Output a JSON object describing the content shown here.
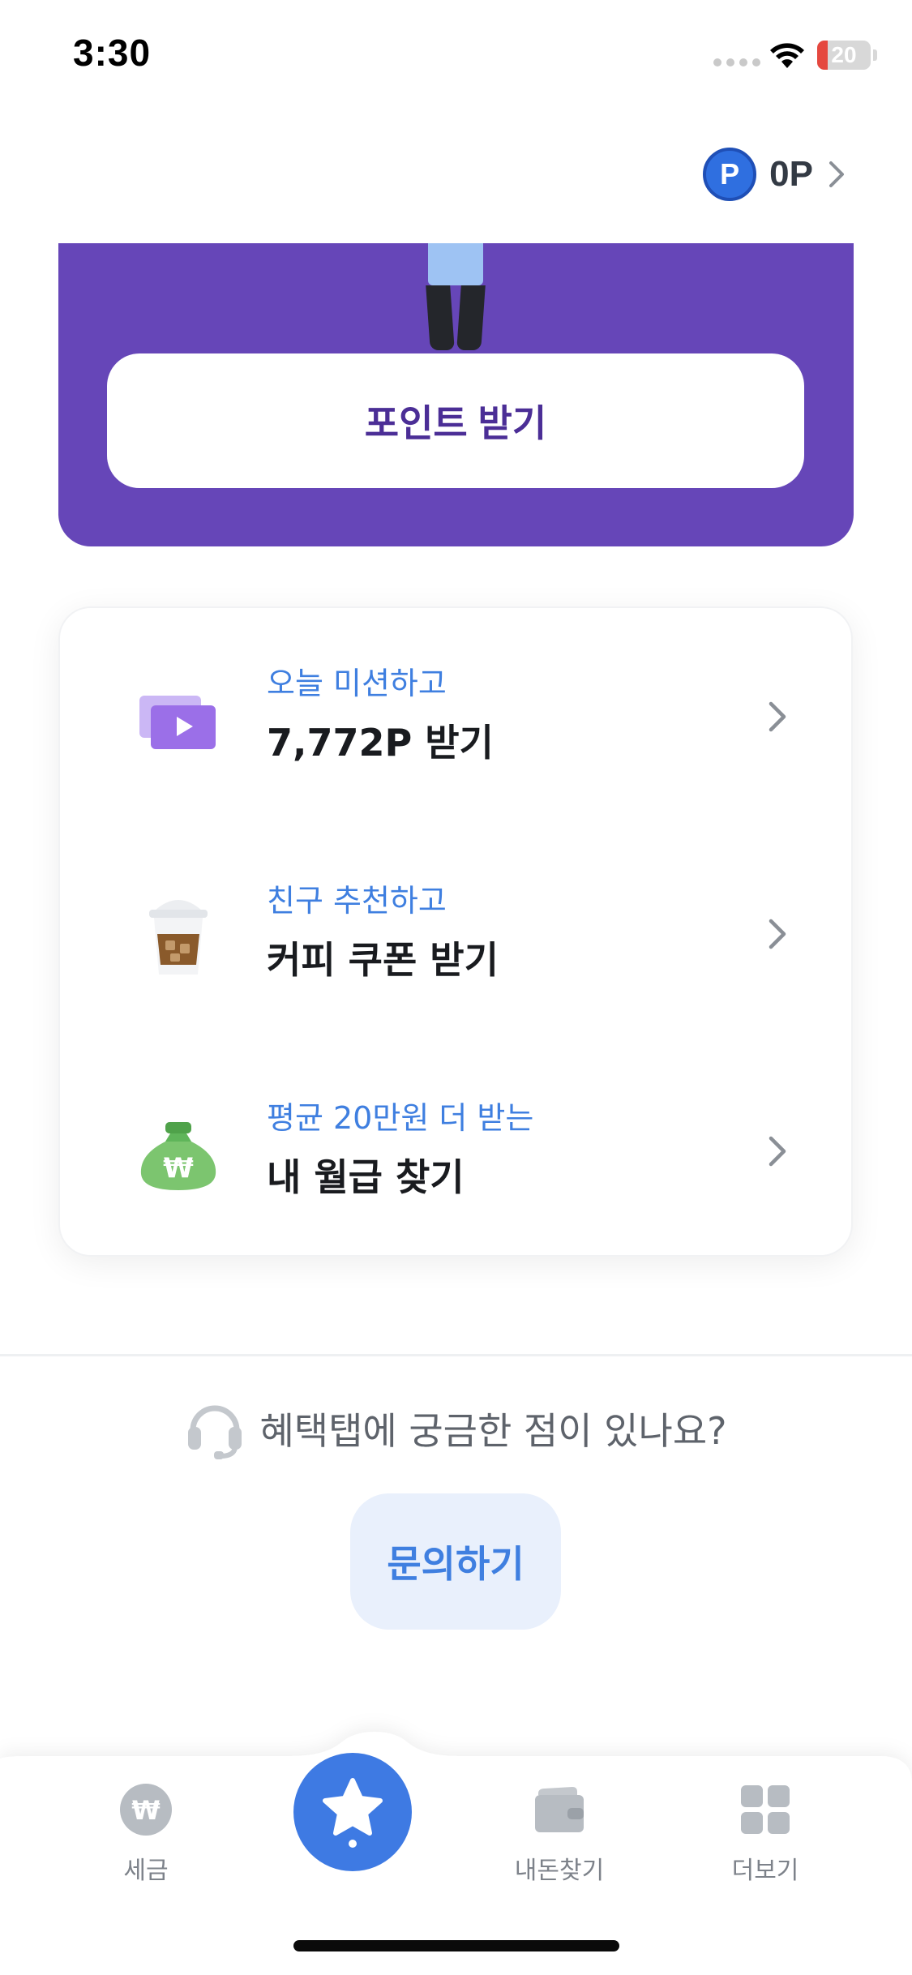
{
  "status_bar": {
    "time": "3:30",
    "battery": "20",
    "battery_level": 0.2
  },
  "header": {
    "point_badge": "P",
    "point_amount": "0P"
  },
  "banner": {
    "button_label": "포인트 받기"
  },
  "missions": [
    {
      "subtitle": "오늘 미션하고",
      "title": "7,772P 받기",
      "icon": "video-play-icon"
    },
    {
      "subtitle": "친구 추천하고",
      "title": "커피 쿠폰 받기",
      "icon": "iced-coffee-icon"
    },
    {
      "subtitle": "평균 20만원 더 받는",
      "title": "내 월급 찾기",
      "icon": "money-bag-icon"
    }
  ],
  "help": {
    "question": "혜택탭에 궁금한 점이 있나요?",
    "button_label": "문의하기"
  },
  "bottom_nav": {
    "items": [
      {
        "label": "세금",
        "icon": "won-coin-icon"
      },
      {
        "label": "",
        "icon": "star-icon",
        "active": true
      },
      {
        "label": "내돈찾기",
        "icon": "wallet-icon"
      },
      {
        "label": "더보기",
        "icon": "grid-icon"
      }
    ]
  },
  "colors": {
    "banner_purple": "#6646b8",
    "accent_blue": "#3e7ae3",
    "subtitle_blue": "#3f7fe0",
    "inquiry_bg": "#e9f0fc"
  }
}
